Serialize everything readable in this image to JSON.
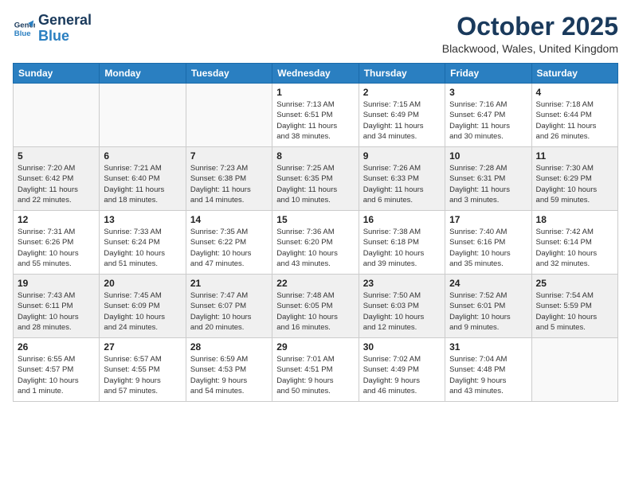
{
  "logo": {
    "line1": "General",
    "line2": "Blue"
  },
  "title": "October 2025",
  "location": "Blackwood, Wales, United Kingdom",
  "days_of_week": [
    "Sunday",
    "Monday",
    "Tuesday",
    "Wednesday",
    "Thursday",
    "Friday",
    "Saturday"
  ],
  "weeks": [
    {
      "shade": "white",
      "days": [
        {
          "number": "",
          "info": ""
        },
        {
          "number": "",
          "info": ""
        },
        {
          "number": "",
          "info": ""
        },
        {
          "number": "1",
          "info": "Sunrise: 7:13 AM\nSunset: 6:51 PM\nDaylight: 11 hours\nand 38 minutes."
        },
        {
          "number": "2",
          "info": "Sunrise: 7:15 AM\nSunset: 6:49 PM\nDaylight: 11 hours\nand 34 minutes."
        },
        {
          "number": "3",
          "info": "Sunrise: 7:16 AM\nSunset: 6:47 PM\nDaylight: 11 hours\nand 30 minutes."
        },
        {
          "number": "4",
          "info": "Sunrise: 7:18 AM\nSunset: 6:44 PM\nDaylight: 11 hours\nand 26 minutes."
        }
      ]
    },
    {
      "shade": "shade",
      "days": [
        {
          "number": "5",
          "info": "Sunrise: 7:20 AM\nSunset: 6:42 PM\nDaylight: 11 hours\nand 22 minutes."
        },
        {
          "number": "6",
          "info": "Sunrise: 7:21 AM\nSunset: 6:40 PM\nDaylight: 11 hours\nand 18 minutes."
        },
        {
          "number": "7",
          "info": "Sunrise: 7:23 AM\nSunset: 6:38 PM\nDaylight: 11 hours\nand 14 minutes."
        },
        {
          "number": "8",
          "info": "Sunrise: 7:25 AM\nSunset: 6:35 PM\nDaylight: 11 hours\nand 10 minutes."
        },
        {
          "number": "9",
          "info": "Sunrise: 7:26 AM\nSunset: 6:33 PM\nDaylight: 11 hours\nand 6 minutes."
        },
        {
          "number": "10",
          "info": "Sunrise: 7:28 AM\nSunset: 6:31 PM\nDaylight: 11 hours\nand 3 minutes."
        },
        {
          "number": "11",
          "info": "Sunrise: 7:30 AM\nSunset: 6:29 PM\nDaylight: 10 hours\nand 59 minutes."
        }
      ]
    },
    {
      "shade": "white",
      "days": [
        {
          "number": "12",
          "info": "Sunrise: 7:31 AM\nSunset: 6:26 PM\nDaylight: 10 hours\nand 55 minutes."
        },
        {
          "number": "13",
          "info": "Sunrise: 7:33 AM\nSunset: 6:24 PM\nDaylight: 10 hours\nand 51 minutes."
        },
        {
          "number": "14",
          "info": "Sunrise: 7:35 AM\nSunset: 6:22 PM\nDaylight: 10 hours\nand 47 minutes."
        },
        {
          "number": "15",
          "info": "Sunrise: 7:36 AM\nSunset: 6:20 PM\nDaylight: 10 hours\nand 43 minutes."
        },
        {
          "number": "16",
          "info": "Sunrise: 7:38 AM\nSunset: 6:18 PM\nDaylight: 10 hours\nand 39 minutes."
        },
        {
          "number": "17",
          "info": "Sunrise: 7:40 AM\nSunset: 6:16 PM\nDaylight: 10 hours\nand 35 minutes."
        },
        {
          "number": "18",
          "info": "Sunrise: 7:42 AM\nSunset: 6:14 PM\nDaylight: 10 hours\nand 32 minutes."
        }
      ]
    },
    {
      "shade": "shade",
      "days": [
        {
          "number": "19",
          "info": "Sunrise: 7:43 AM\nSunset: 6:11 PM\nDaylight: 10 hours\nand 28 minutes."
        },
        {
          "number": "20",
          "info": "Sunrise: 7:45 AM\nSunset: 6:09 PM\nDaylight: 10 hours\nand 24 minutes."
        },
        {
          "number": "21",
          "info": "Sunrise: 7:47 AM\nSunset: 6:07 PM\nDaylight: 10 hours\nand 20 minutes."
        },
        {
          "number": "22",
          "info": "Sunrise: 7:48 AM\nSunset: 6:05 PM\nDaylight: 10 hours\nand 16 minutes."
        },
        {
          "number": "23",
          "info": "Sunrise: 7:50 AM\nSunset: 6:03 PM\nDaylight: 10 hours\nand 12 minutes."
        },
        {
          "number": "24",
          "info": "Sunrise: 7:52 AM\nSunset: 6:01 PM\nDaylight: 10 hours\nand 9 minutes."
        },
        {
          "number": "25",
          "info": "Sunrise: 7:54 AM\nSunset: 5:59 PM\nDaylight: 10 hours\nand 5 minutes."
        }
      ]
    },
    {
      "shade": "white",
      "days": [
        {
          "number": "26",
          "info": "Sunrise: 6:55 AM\nSunset: 4:57 PM\nDaylight: 10 hours\nand 1 minute."
        },
        {
          "number": "27",
          "info": "Sunrise: 6:57 AM\nSunset: 4:55 PM\nDaylight: 9 hours\nand 57 minutes."
        },
        {
          "number": "28",
          "info": "Sunrise: 6:59 AM\nSunset: 4:53 PM\nDaylight: 9 hours\nand 54 minutes."
        },
        {
          "number": "29",
          "info": "Sunrise: 7:01 AM\nSunset: 4:51 PM\nDaylight: 9 hours\nand 50 minutes."
        },
        {
          "number": "30",
          "info": "Sunrise: 7:02 AM\nSunset: 4:49 PM\nDaylight: 9 hours\nand 46 minutes."
        },
        {
          "number": "31",
          "info": "Sunrise: 7:04 AM\nSunset: 4:48 PM\nDaylight: 9 hours\nand 43 minutes."
        },
        {
          "number": "",
          "info": ""
        }
      ]
    }
  ]
}
